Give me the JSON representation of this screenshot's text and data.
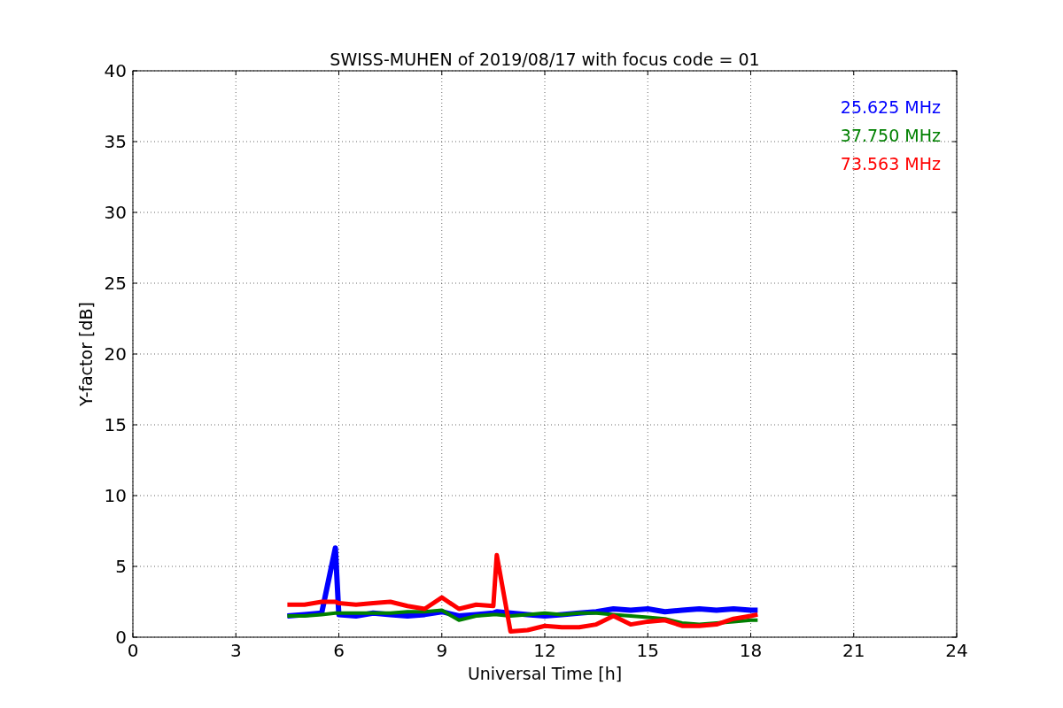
{
  "chart_data": {
    "type": "line",
    "title": "SWISS-MUHEN of 2019/08/17 with focus code = 01",
    "xlabel": "Universal Time [h]",
    "ylabel": "Y-factor [dB]",
    "x": [
      4.5,
      5,
      5.5,
      5.9,
      6,
      6.5,
      7,
      7.5,
      8,
      8.5,
      9,
      9.5,
      10,
      10.5,
      10.6,
      11,
      11.5,
      12,
      12.5,
      13,
      13.5,
      14,
      14.5,
      15,
      15.5,
      16,
      16.5,
      17,
      17.5,
      18,
      18.2
    ],
    "series": [
      {
        "name": "25.625 MHz",
        "color": "#0000ff",
        "values": [
          1.5,
          1.6,
          1.7,
          6.3,
          1.6,
          1.5,
          1.7,
          1.6,
          1.5,
          1.6,
          1.8,
          1.5,
          1.6,
          1.7,
          1.8,
          1.7,
          1.6,
          1.5,
          1.6,
          1.7,
          1.8,
          2.0,
          1.9,
          2.0,
          1.8,
          1.9,
          2.0,
          1.9,
          2.0,
          1.9,
          1.9
        ]
      },
      {
        "name": "37.750 MHz",
        "color": "#008000",
        "values": [
          1.5,
          1.5,
          1.6,
          1.7,
          1.7,
          1.7,
          1.7,
          1.7,
          1.8,
          1.8,
          1.9,
          1.2,
          1.5,
          1.6,
          1.6,
          1.5,
          1.6,
          1.7,
          1.6,
          1.7,
          1.7,
          1.6,
          1.5,
          1.4,
          1.3,
          1.0,
          0.9,
          1.0,
          1.1,
          1.2,
          1.2
        ]
      },
      {
        "name": "73.563 MHz",
        "color": "#ff0000",
        "values": [
          2.3,
          2.3,
          2.5,
          2.5,
          2.4,
          2.3,
          2.4,
          2.5,
          2.2,
          2.0,
          2.8,
          2.0,
          2.3,
          2.2,
          5.8,
          0.4,
          0.5,
          0.8,
          0.7,
          0.7,
          0.9,
          1.5,
          0.9,
          1.1,
          1.2,
          0.8,
          0.8,
          0.9,
          1.3,
          1.5,
          1.6
        ]
      }
    ],
    "grid": true,
    "xlim": [
      0,
      24
    ],
    "ylim": [
      0,
      40
    ],
    "xticks": [
      0,
      3,
      6,
      9,
      12,
      15,
      18,
      21,
      24
    ],
    "yticks": [
      0,
      5,
      10,
      15,
      20,
      25,
      30,
      35,
      40
    ]
  }
}
